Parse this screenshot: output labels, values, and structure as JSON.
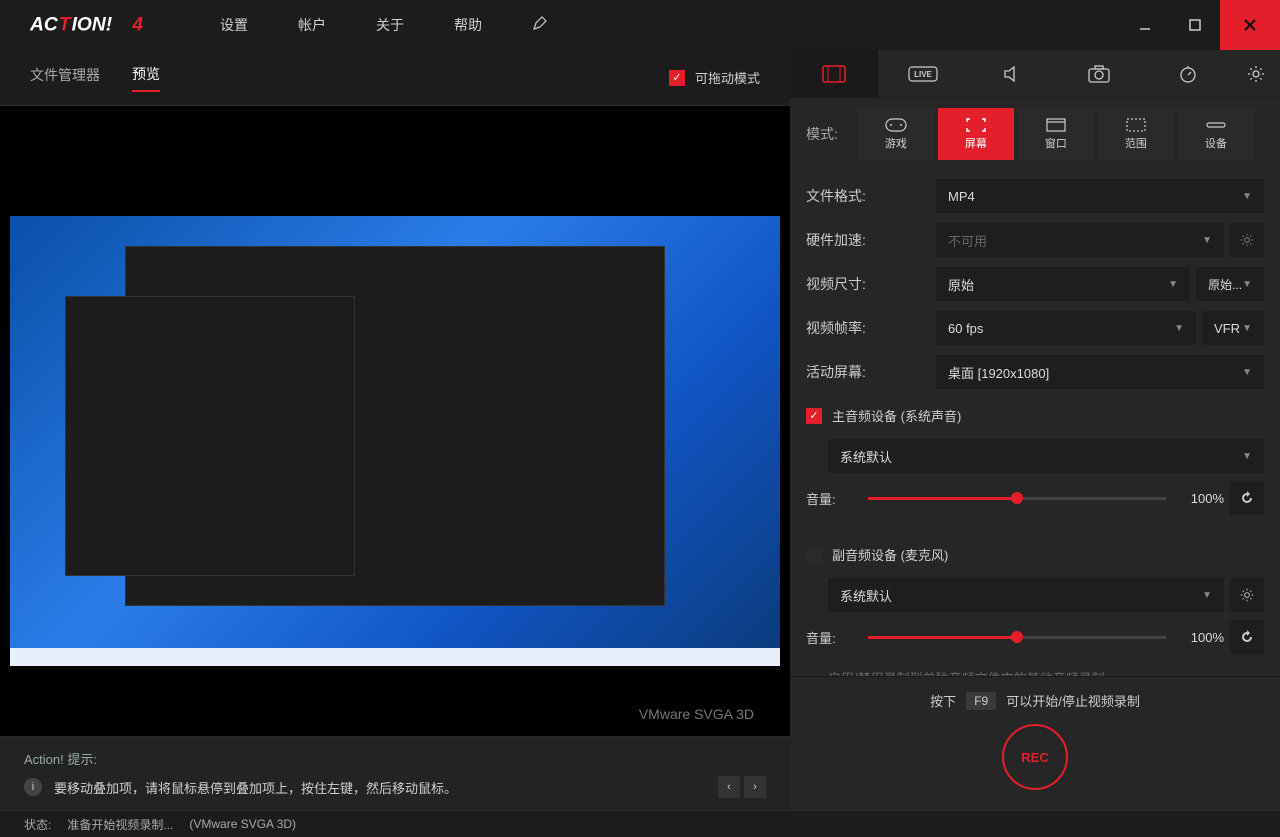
{
  "menu": {
    "settings": "设置",
    "account": "帐户",
    "about": "关于",
    "help": "帮助"
  },
  "left_tabs": {
    "file_manager": "文件管理器",
    "preview": "预览",
    "drag_mode_label": "可拖动模式"
  },
  "preview": {
    "device_label": "VMware SVGA 3D"
  },
  "tip": {
    "title": "Action! 提示:",
    "text": "要移动叠加项，请将鼠标悬停到叠加项上，按住左键，然后移动鼠标。"
  },
  "status": {
    "label": "状态:",
    "text": "准备开始视频录制...",
    "gpu": "(VMware SVGA 3D)"
  },
  "modes": {
    "label": "模式:",
    "game": "游戏",
    "screen": "屏幕",
    "window": "窗口",
    "region": "范围",
    "device": "设备"
  },
  "settings": {
    "file_format_label": "文件格式:",
    "file_format_value": "MP4",
    "hw_accel_label": "硬件加速:",
    "hw_accel_value": "不可用",
    "video_size_label": "视频尺寸:",
    "video_size_value": "原始",
    "video_size_secondary": "原始...",
    "fps_label": "视频帧率:",
    "fps_value": "60 fps",
    "fps_mode": "VFR",
    "active_screen_label": "活动屏幕:",
    "active_screen_value": "桌面 [1920x1080]"
  },
  "audio": {
    "primary_label": "主音频设备 (系统声音)",
    "secondary_label": "副音频设备 (麦克风)",
    "device_default": "系统默认",
    "volume_label": "音量:",
    "volume_value": "100%",
    "extra_hint": "启用/禁用录制到单独音频文件中的其他音频录制"
  },
  "rec": {
    "hint_pre": "按下",
    "hint_key": "F9",
    "hint_post": "可以开始/停止视频录制",
    "btn": "REC"
  }
}
